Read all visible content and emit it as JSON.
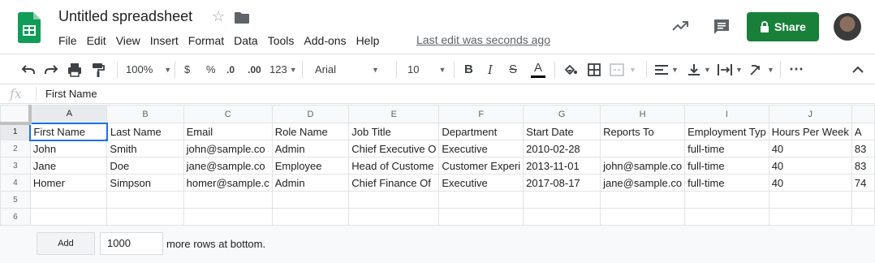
{
  "app": {
    "title": "Untitled spreadsheet",
    "last_edit": "Last edit was seconds ago",
    "share_label": "Share",
    "menu": [
      "File",
      "Edit",
      "View",
      "Insert",
      "Format",
      "Data",
      "Tools",
      "Add-ons",
      "Help"
    ]
  },
  "toolbar": {
    "zoom": "100%",
    "currency": "$",
    "percent": "%",
    "dec_decrease": ".0",
    "dec_increase": ".00",
    "more_formats": "123",
    "font": "Arial",
    "font_size": "10",
    "bold": "B",
    "italic": "I",
    "strike": "S",
    "text_color": "A",
    "more": "⋯"
  },
  "formula_bar": {
    "fx": "fx",
    "value": "First Name"
  },
  "sheet": {
    "columns": [
      "A",
      "B",
      "C",
      "D",
      "E",
      "F",
      "G",
      "H",
      "I",
      "J"
    ],
    "rows": [
      {
        "num": "1",
        "cells": [
          "First Name",
          "Last Name",
          "Email",
          "Role Name",
          "Job Title",
          "Department",
          "Start Date",
          "Reports To",
          "Employment Typ",
          "Hours Per Week",
          "A"
        ]
      },
      {
        "num": "2",
        "cells": [
          "John",
          "Smith",
          "john@sample.co",
          "Admin",
          "Chief Executive O",
          "Executive",
          "2010-02-28",
          "",
          "full-time",
          "40",
          "83"
        ]
      },
      {
        "num": "3",
        "cells": [
          "Jane",
          "Doe",
          "jane@sample.co",
          "Employee",
          "Head of Custome",
          "Customer Experi",
          "2013-11-01",
          "john@sample.co",
          "full-time",
          "40",
          "83"
        ]
      },
      {
        "num": "4",
        "cells": [
          "Homer",
          "Simpson",
          "homer@sample.c",
          "Admin",
          "Chief Finance Of",
          "Executive",
          "2017-08-17",
          "jane@sample.co",
          "full-time",
          "40",
          "74"
        ]
      },
      {
        "num": "5",
        "cells": [
          "",
          "",
          "",
          "",
          "",
          "",
          "",
          "",
          "",
          "",
          ""
        ]
      },
      {
        "num": "6",
        "cells": [
          "",
          "",
          "",
          "",
          "",
          "",
          "",
          "",
          "",
          "",
          ""
        ]
      }
    ]
  },
  "footer": {
    "add_label": "Add",
    "rows_value": "1000",
    "more_text": "more rows at bottom."
  },
  "colors": {
    "share_green": "#188038",
    "selection_blue": "#1a73e8",
    "sheets_logo_green": "#0f9d58"
  }
}
